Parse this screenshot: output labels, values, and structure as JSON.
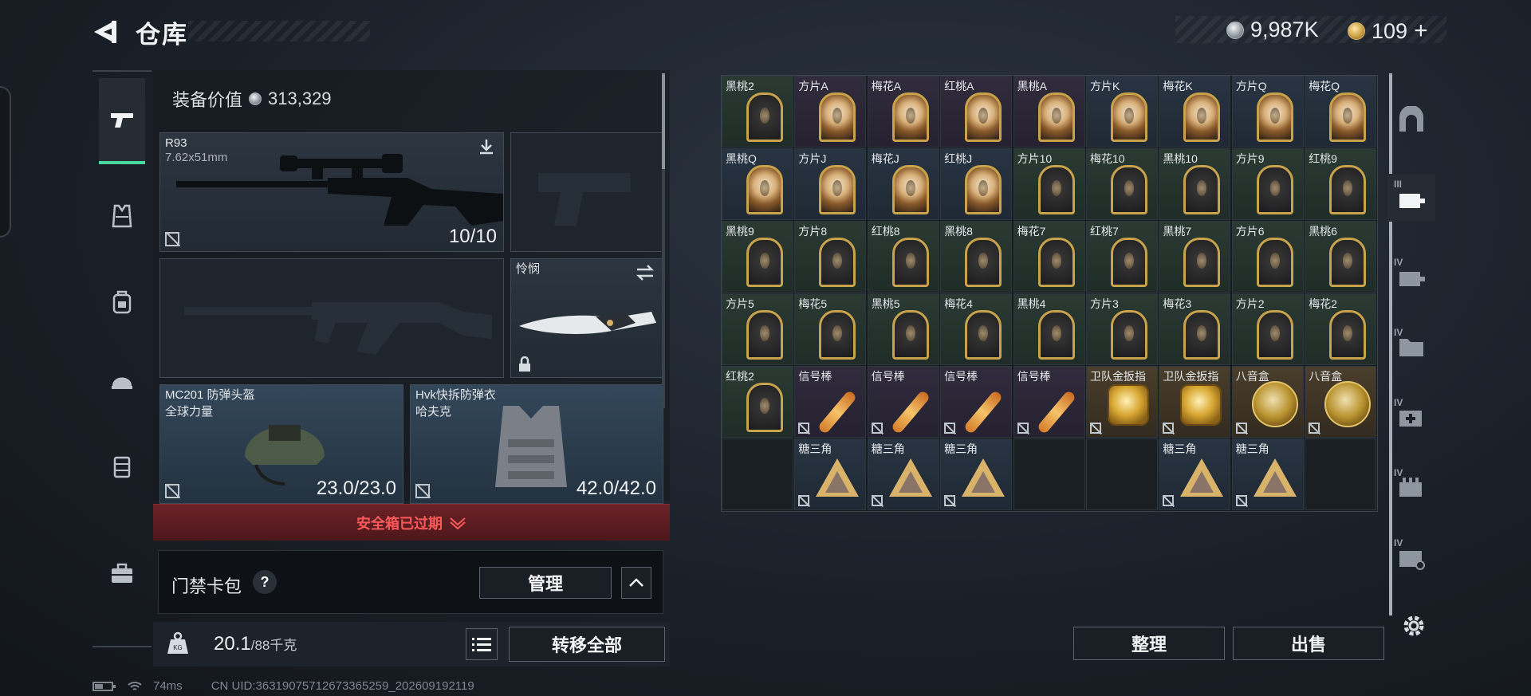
{
  "header": {
    "title": "仓库",
    "currency_silver": "9,987K",
    "currency_gold": "109",
    "currency_gold_add": "+"
  },
  "left_nav": {
    "items": [
      {
        "name": "weapons",
        "icon": "pistol-icon"
      },
      {
        "name": "armor",
        "icon": "vest-icon"
      },
      {
        "name": "backpack",
        "icon": "backpack-icon"
      },
      {
        "name": "helmet",
        "icon": "helmet-icon"
      },
      {
        "name": "container",
        "icon": "container-icon"
      },
      {
        "name": "case",
        "icon": "briefcase-icon"
      }
    ]
  },
  "loadout": {
    "equip_value_label": "装备价值",
    "equip_value": "313,329",
    "primary": {
      "name": "R93",
      "caliber": "7.62x51mm",
      "durability": "10/10"
    },
    "melee": {
      "name": "怜悯"
    },
    "helmet": {
      "name": "MC201 防弹头盔",
      "sub": "全球力量",
      "durability": "23.0/23.0"
    },
    "armor": {
      "name": "Hvk快拆防弹衣",
      "sub": "哈夫克",
      "durability": "42.0/42.0"
    },
    "safe_box_expired": "安全箱已过期",
    "keybag_label": "门禁卡包",
    "keybag_help": "?",
    "manage_label": "管理",
    "weight_current": "20.1",
    "weight_max": "/88千克",
    "transfer_all_label": "转移全部"
  },
  "status_bar": {
    "ping": "74ms",
    "uid": "CN UID:36319075712673365259_202609192119"
  },
  "inventory": {
    "rows": [
      [
        {
          "label": "黑桃2",
          "kind": "card",
          "bg": "green"
        },
        {
          "label": "方片A",
          "kind": "face",
          "bg": "purple"
        },
        {
          "label": "梅花A",
          "kind": "face",
          "bg": "purple"
        },
        {
          "label": "红桃A",
          "kind": "face",
          "bg": "purple"
        },
        {
          "label": "黑桃A",
          "kind": "face",
          "bg": "purple"
        },
        {
          "label": "方片K",
          "kind": "face",
          "bg": "blue"
        },
        {
          "label": "梅花K",
          "kind": "face",
          "bg": "blue"
        },
        {
          "label": "方片Q",
          "kind": "face",
          "bg": "blue"
        },
        {
          "label": "梅花Q",
          "kind": "face",
          "bg": "blue"
        }
      ],
      [
        {
          "label": "黑桃Q",
          "kind": "face",
          "bg": "blue"
        },
        {
          "label": "方片J",
          "kind": "face",
          "bg": "blue"
        },
        {
          "label": "梅花J",
          "kind": "face",
          "bg": "blue"
        },
        {
          "label": "红桃J",
          "kind": "face",
          "bg": "blue"
        },
        {
          "label": "方片10",
          "kind": "card",
          "bg": "green"
        },
        {
          "label": "梅花10",
          "kind": "card",
          "bg": "green"
        },
        {
          "label": "黑桃10",
          "kind": "card",
          "bg": "green"
        },
        {
          "label": "方片9",
          "kind": "card",
          "bg": "green"
        },
        {
          "label": "红桃9",
          "kind": "card",
          "bg": "green"
        }
      ],
      [
        {
          "label": "黑桃9",
          "kind": "card",
          "bg": "green"
        },
        {
          "label": "方片8",
          "kind": "card",
          "bg": "green"
        },
        {
          "label": "红桃8",
          "kind": "card",
          "bg": "green"
        },
        {
          "label": "黑桃8",
          "kind": "card",
          "bg": "green"
        },
        {
          "label": "梅花7",
          "kind": "card",
          "bg": "green"
        },
        {
          "label": "红桃7",
          "kind": "card",
          "bg": "green"
        },
        {
          "label": "黑桃7",
          "kind": "card",
          "bg": "green"
        },
        {
          "label": "方片6",
          "kind": "card",
          "bg": "green"
        },
        {
          "label": "黑桃6",
          "kind": "card",
          "bg": "green"
        }
      ],
      [
        {
          "label": "方片5",
          "kind": "card",
          "bg": "green"
        },
        {
          "label": "梅花5",
          "kind": "card",
          "bg": "green"
        },
        {
          "label": "黑桃5",
          "kind": "card",
          "bg": "green"
        },
        {
          "label": "梅花4",
          "kind": "card",
          "bg": "green"
        },
        {
          "label": "黑桃4",
          "kind": "card",
          "bg": "green"
        },
        {
          "label": "方片3",
          "kind": "card",
          "bg": "green"
        },
        {
          "label": "梅花3",
          "kind": "card",
          "bg": "green"
        },
        {
          "label": "方片2",
          "kind": "card",
          "bg": "green"
        },
        {
          "label": "梅花2",
          "kind": "card",
          "bg": "green"
        }
      ],
      [
        {
          "label": "红桃2",
          "kind": "card",
          "bg": "green"
        },
        {
          "label": "信号棒",
          "kind": "flare",
          "bg": "purple",
          "nodrop": true
        },
        {
          "label": "信号棒",
          "kind": "flare",
          "bg": "purple",
          "nodrop": true
        },
        {
          "label": "信号棒",
          "kind": "flare",
          "bg": "purple",
          "nodrop": true
        },
        {
          "label": "信号棒",
          "kind": "flare",
          "bg": "purple",
          "nodrop": true
        },
        {
          "label": "卫队金扳指",
          "kind": "ring",
          "bg": "gold",
          "nodrop": true
        },
        {
          "label": "卫队金扳指",
          "kind": "ring",
          "bg": "gold",
          "nodrop": true
        },
        {
          "label": "八音盒",
          "kind": "musicbox",
          "bg": "gold",
          "nodrop": true
        },
        {
          "label": "八音盒",
          "kind": "musicbox",
          "bg": "gold",
          "nodrop": true
        }
      ],
      [
        {
          "label": "",
          "kind": "empty",
          "bg": "empty"
        },
        {
          "label": "糖三角",
          "kind": "tri",
          "bg": "blue",
          "nodrop": true
        },
        {
          "label": "糖三角",
          "kind": "tri",
          "bg": "blue",
          "nodrop": true
        },
        {
          "label": "糖三角",
          "kind": "tri",
          "bg": "blue",
          "nodrop": true
        },
        {
          "label": "",
          "kind": "empty",
          "bg": "empty"
        },
        {
          "label": "",
          "kind": "empty",
          "bg": "empty"
        },
        {
          "label": "糖三角",
          "kind": "tri",
          "bg": "blue",
          "nodrop": true
        },
        {
          "label": "糖三角",
          "kind": "tri",
          "bg": "blue",
          "nodrop": true
        },
        {
          "label": "",
          "kind": "empty",
          "bg": "empty"
        }
      ]
    ],
    "sort_label": "整理",
    "sell_label": "出售"
  },
  "right_nav": {
    "items": [
      {
        "name": "storage-main",
        "icon": "arch-icon"
      },
      {
        "name": "storage-3",
        "icon": "rack-icon",
        "level": "III",
        "active": true
      },
      {
        "name": "storage-4a",
        "icon": "rack-icon",
        "level": "IV"
      },
      {
        "name": "storage-4b",
        "icon": "folder-icon",
        "level": "IV"
      },
      {
        "name": "storage-4c",
        "icon": "medkit-icon",
        "level": "IV"
      },
      {
        "name": "storage-4d",
        "icon": "ammo-icon",
        "level": "IV"
      },
      {
        "name": "storage-4e",
        "icon": "box-icon",
        "level": "IV"
      }
    ]
  },
  "colors": {
    "accent_green": "#49d6a0",
    "expire_red": "#ff5a5a"
  }
}
